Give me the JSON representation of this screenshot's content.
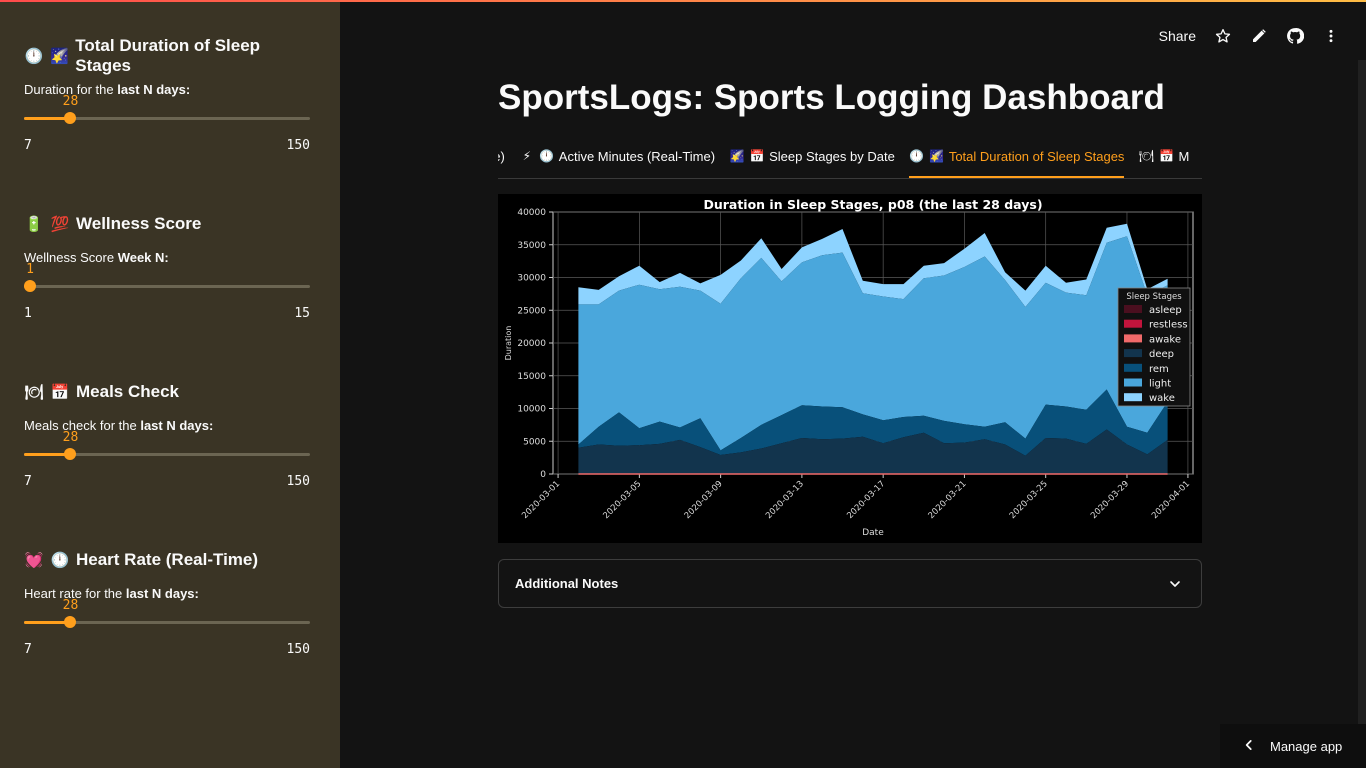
{
  "sidebar": {
    "sections": [
      {
        "icons": [
          "🕛",
          "🌠"
        ],
        "title": "Total Duration of Sleep Stages",
        "label_pre": "Duration for the ",
        "label_bold": "last N days:",
        "slider": {
          "value": "28",
          "min": "7",
          "max": "150",
          "fraction": 0.1477
        }
      },
      {
        "icons": [
          "🔋",
          "💯"
        ],
        "title": "Wellness Score",
        "label_pre": "Wellness Score ",
        "label_bold": "Week N:",
        "slider": {
          "value": "1",
          "min": "1",
          "max": "15",
          "fraction": 0
        }
      },
      {
        "icons": [
          "🍽",
          "📅"
        ],
        "title": "Meals Check",
        "label_pre": "Meals check for the ",
        "label_bold": "last N days:",
        "slider": {
          "value": "28",
          "min": "7",
          "max": "150",
          "fraction": 0.1477
        }
      },
      {
        "icons": [
          "💓",
          "🕛"
        ],
        "title": "Heart Rate (Real-Time)",
        "label_pre": "Heart rate for the ",
        "label_bold": "last N days:",
        "slider": {
          "value": "28",
          "min": "7",
          "max": "150",
          "fraction": 0.1477
        }
      }
    ]
  },
  "toolbar": {
    "share_label": "Share",
    "icons": [
      "star-icon",
      "edit-pencil-icon",
      "github-icon",
      "more-vertical-icon"
    ]
  },
  "main": {
    "title": "SportsLogs: Sports Logging Dashboard",
    "tabs": [
      {
        "label": "ne)",
        "icons": []
      },
      {
        "label": "Active Minutes (Real-Time)",
        "icons": [
          "⚡",
          "🕛"
        ]
      },
      {
        "label": "Sleep Stages by Date",
        "icons": [
          "🌠",
          "📅"
        ]
      },
      {
        "label": "Total Duration of Sleep Stages",
        "icons": [
          "🕛",
          "🌠"
        ],
        "active": true
      },
      {
        "label": "M",
        "icons": [
          "🍽",
          "📅"
        ]
      }
    ],
    "expander_label": "Additional Notes",
    "manage_label": "Manage app"
  },
  "colors": {
    "accent": "#ff9f1c",
    "sidebar_bg": "#3a3425",
    "main_bg": "#131313"
  },
  "chart_data": {
    "type": "area",
    "title": "Duration in Sleep Stages, p08 (the last 28 days)",
    "xlabel": "Date",
    "ylabel": "Duration",
    "ylim": [
      0,
      40000
    ],
    "xlim": [
      "2020-03-01",
      "2020-04-01"
    ],
    "yticks": [
      "0",
      "5000",
      "10000",
      "15000",
      "20000",
      "25000",
      "30000",
      "35000",
      "40000"
    ],
    "xticks": [
      "2020-03-01",
      "2020-03-05",
      "2020-03-09",
      "2020-03-13",
      "2020-03-17",
      "2020-03-21",
      "2020-03-25",
      "2020-03-29",
      "2020-04-01"
    ],
    "grid": true,
    "legend": {
      "title": "Sleep Stages",
      "placement": "right"
    },
    "x": [
      "2020-03-02",
      "2020-03-03",
      "2020-03-04",
      "2020-03-05",
      "2020-03-06",
      "2020-03-07",
      "2020-03-08",
      "2020-03-09",
      "2020-03-10",
      "2020-03-11",
      "2020-03-12",
      "2020-03-13",
      "2020-03-14",
      "2020-03-15",
      "2020-03-16",
      "2020-03-17",
      "2020-03-18",
      "2020-03-19",
      "2020-03-20",
      "2020-03-21",
      "2020-03-22",
      "2020-03-23",
      "2020-03-24",
      "2020-03-25",
      "2020-03-26",
      "2020-03-27",
      "2020-03-28",
      "2020-03-29",
      "2020-03-30",
      "2020-03-31"
    ],
    "stack_totals": [
      {
        "name": "asleep",
        "color": "#4a0f1f",
        "values": [
          0,
          0,
          0,
          0,
          0,
          0,
          0,
          0,
          0,
          0,
          0,
          0,
          0,
          0,
          0,
          0,
          0,
          0,
          0,
          0,
          0,
          0,
          0,
          0,
          0,
          0,
          0,
          0,
          0,
          0
        ]
      },
      {
        "name": "restless",
        "color": "#c2143c",
        "values": [
          0,
          0,
          0,
          0,
          0,
          0,
          0,
          0,
          0,
          0,
          0,
          0,
          0,
          0,
          0,
          0,
          0,
          0,
          0,
          0,
          0,
          0,
          0,
          0,
          0,
          0,
          0,
          0,
          0,
          0
        ]
      },
      {
        "name": "awake",
        "color": "#f06a6a",
        "values": [
          0,
          0,
          0,
          0,
          0,
          0,
          0,
          0,
          0,
          0,
          0,
          0,
          0,
          0,
          0,
          0,
          0,
          0,
          0,
          0,
          0,
          0,
          0,
          0,
          0,
          0,
          0,
          0,
          0,
          0
        ]
      },
      {
        "name": "deep",
        "color": "#12344d",
        "values": [
          4000,
          4500,
          4300,
          4400,
          4600,
          5200,
          4100,
          2900,
          3300,
          3900,
          4700,
          5500,
          5300,
          5400,
          5700,
          4700,
          5600,
          6300,
          4700,
          4800,
          5300,
          4500,
          2800,
          5500,
          5400,
          4600,
          6800,
          4500,
          3000,
          5200
        ]
      },
      {
        "name": "rem",
        "color": "#08507a",
        "values": [
          4500,
          7200,
          9400,
          7000,
          8000,
          7100,
          8500,
          3600,
          5500,
          7500,
          9000,
          10500,
          10300,
          10200,
          9100,
          8200,
          8700,
          8900,
          8100,
          7600,
          7200,
          7900,
          5400,
          10600,
          10300,
          9800,
          12900,
          7200,
          6300,
          11000
        ]
      },
      {
        "name": "light",
        "color": "#4aa7dc",
        "values": [
          25900,
          25900,
          28000,
          28900,
          28200,
          28600,
          28000,
          26000,
          29900,
          33000,
          29400,
          32300,
          33400,
          33800,
          27600,
          27100,
          26700,
          29900,
          30300,
          31600,
          33200,
          29600,
          25500,
          29200,
          27700,
          27300,
          35300,
          36300,
          27300,
          28800
        ]
      },
      {
        "name": "wake",
        "color": "#8dd3ff",
        "values": [
          28500,
          28100,
          30200,
          31800,
          29300,
          30700,
          29100,
          30400,
          32600,
          36000,
          31300,
          34600,
          35900,
          37400,
          29500,
          29000,
          29000,
          31800,
          32200,
          34400,
          36800,
          30800,
          28000,
          31800,
          29200,
          29700,
          37600,
          38200,
          28200,
          29800
        ]
      }
    ]
  }
}
